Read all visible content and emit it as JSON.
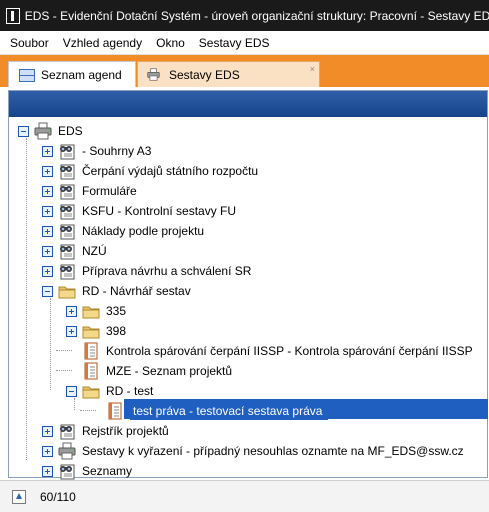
{
  "window": {
    "title": "EDS - Evidenční Dotační Systém - úroveň organizační struktury: Pracovní - Sestavy EDS"
  },
  "menu": {
    "items": [
      "Soubor",
      "Vzhled agendy",
      "Okno",
      "Sestavy EDS"
    ]
  },
  "tabs": [
    {
      "label": "Seznam agend",
      "active": true,
      "icon": "grid-icon"
    },
    {
      "label": "Sestavy EDS",
      "active": false,
      "icon": "printer-icon",
      "close": "×"
    }
  ],
  "tree": {
    "nodes": [
      {
        "label": "EDS",
        "icon": "printer-icon",
        "expander": "minus"
      },
      {
        "label": " - Souhrny A3",
        "icon": "binoculars-report-icon",
        "expander": "plus"
      },
      {
        "label": "Čerpání výdajů státního rozpočtu",
        "icon": "binoculars-report-icon",
        "expander": "plus"
      },
      {
        "label": "Formuláře",
        "icon": "binoculars-report-icon",
        "expander": "plus"
      },
      {
        "label": "KSFU - Kontrolní sestavy FU",
        "icon": "binoculars-report-icon",
        "expander": "plus"
      },
      {
        "label": "Náklady podle projektu",
        "icon": "binoculars-report-icon",
        "expander": "plus"
      },
      {
        "label": "NZÚ",
        "icon": "binoculars-report-icon",
        "expander": "plus"
      },
      {
        "label": "Příprava návrhu a schválení SR",
        "icon": "binoculars-report-icon",
        "expander": "plus"
      },
      {
        "label": "RD - Návrhář sestav",
        "icon": "folder-icon",
        "expander": "minus"
      },
      {
        "label": "335",
        "icon": "folder-icon",
        "expander": "plus"
      },
      {
        "label": "398",
        "icon": "folder-icon",
        "expander": "plus"
      },
      {
        "label": "Kontrola spárování čerpání IISSP - Kontrola spárování čerpání IISSP",
        "icon": "report-document-icon",
        "expander": "none"
      },
      {
        "label": "MZE - Seznam projektů",
        "icon": "report-document-icon",
        "expander": "none"
      },
      {
        "label": "RD - test",
        "icon": "folder-icon",
        "expander": "minus"
      },
      {
        "label": "test práva - testovací sestava práva",
        "icon": "report-document-icon",
        "expander": "none",
        "selected": true
      },
      {
        "label": "Rejstřík projektů",
        "icon": "binoculars-report-icon",
        "expander": "plus"
      },
      {
        "label": "Sestavy k vyřazení - případný nesouhlas oznamte na MF_EDS@ssw.cz",
        "icon": "printer-icon",
        "expander": "plus"
      },
      {
        "label": "Seznamy",
        "icon": "binoculars-report-icon",
        "expander": "plus"
      }
    ]
  },
  "status": {
    "record_count": "60/110",
    "icon": "up-arrow-icon"
  },
  "colors": {
    "titlebar": "#1a1a1a",
    "tabstrip": "#f28c28",
    "tree_header": "#1f4f9c",
    "selection": "#1f5fbf"
  }
}
